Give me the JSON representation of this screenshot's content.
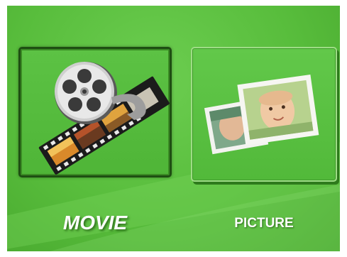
{
  "menu": {
    "items": [
      {
        "label": "MOVIE",
        "icon": "film-reel-icon",
        "selected": true
      },
      {
        "label": "PICTURE",
        "icon": "photos-icon",
        "selected": false
      }
    ]
  },
  "colors": {
    "background": "#58bd3c",
    "selected_border": "#1e4e12",
    "label_text": "#ffffff"
  }
}
